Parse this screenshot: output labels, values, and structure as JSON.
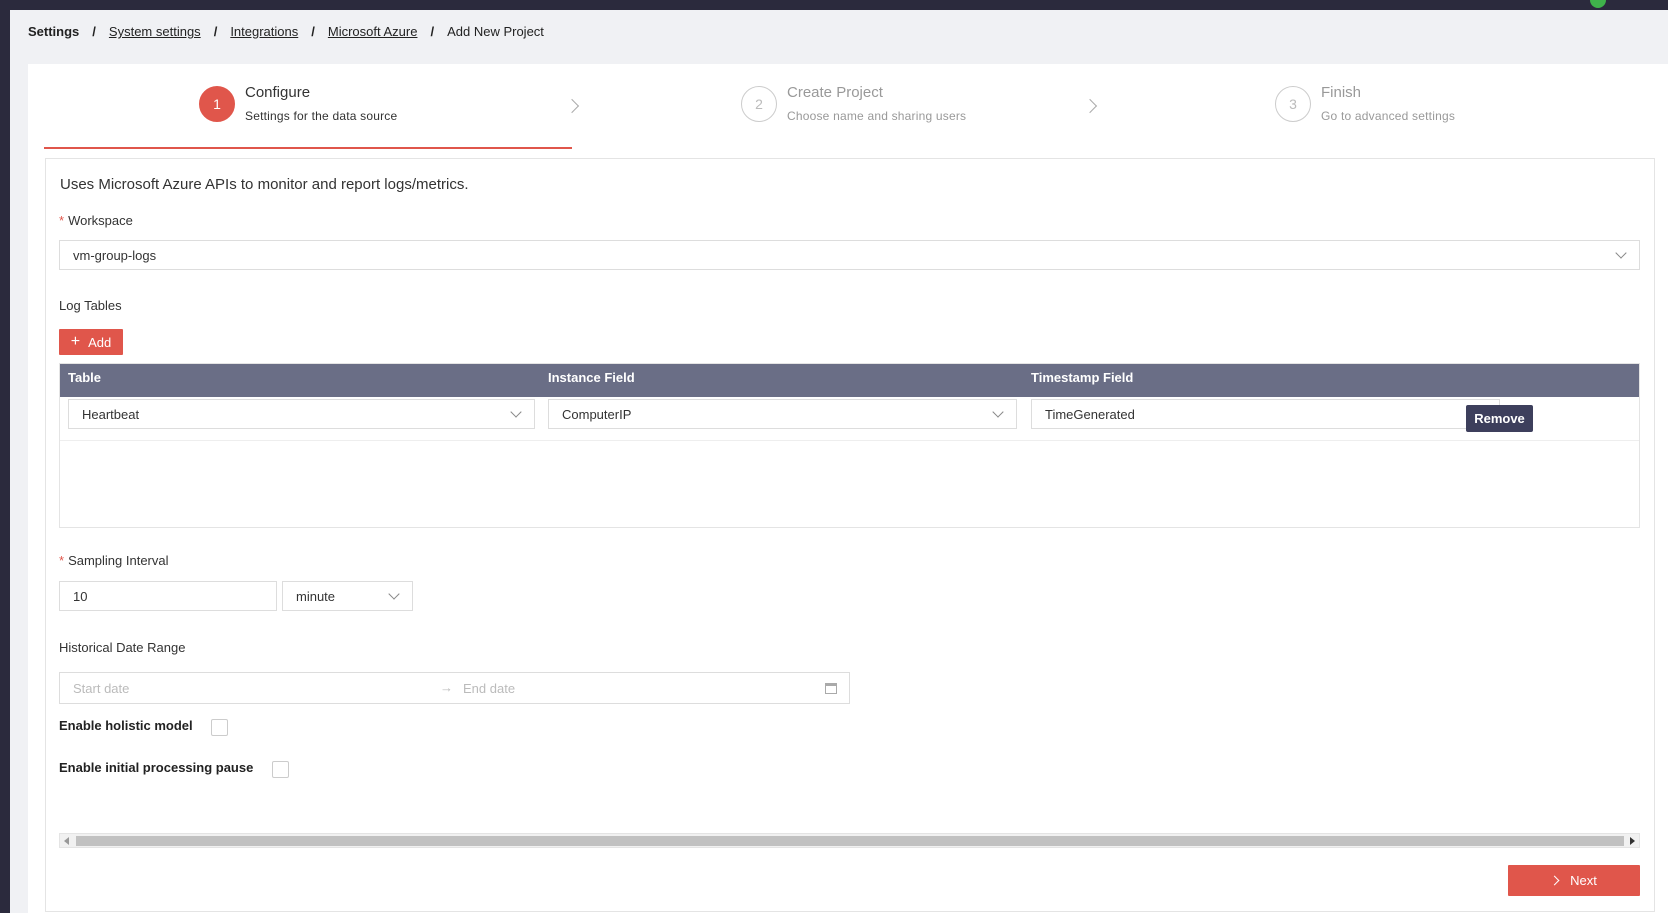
{
  "breadcrumb": {
    "root": "Settings",
    "items": [
      "System settings",
      "Integrations",
      "Microsoft Azure"
    ],
    "current": "Add New Project",
    "separator": "/"
  },
  "steps": [
    {
      "number": "1",
      "title": "Configure",
      "subtitle": "Settings for the data source",
      "active": true
    },
    {
      "number": "2",
      "title": "Create Project",
      "subtitle": "Choose name and sharing users",
      "active": false
    },
    {
      "number": "3",
      "title": "Finish",
      "subtitle": "Go to advanced settings",
      "active": false
    }
  ],
  "form": {
    "description": "Uses Microsoft Azure APIs to monitor and report logs/metrics.",
    "required_marker": "*",
    "workspace": {
      "label": "Workspace",
      "value": "vm-group-logs"
    },
    "log_tables": {
      "label": "Log Tables",
      "add_label": "Add",
      "columns": [
        "Table",
        "Instance Field",
        "Timestamp Field"
      ],
      "rows": [
        {
          "table": "Heartbeat",
          "instance_field": "ComputerIP",
          "timestamp_field": "TimeGenerated",
          "remove_label": "Remove"
        }
      ]
    },
    "sampling_interval": {
      "label": "Sampling Interval",
      "value": "10",
      "unit": "minute"
    },
    "historical_date_range": {
      "label": "Historical Date Range",
      "start_placeholder": "Start date",
      "end_placeholder": "End date",
      "arrow": "→"
    },
    "enable_holistic_model": {
      "label": "Enable holistic model",
      "checked": false
    },
    "enable_initial_processing_pause": {
      "label": "Enable initial processing pause",
      "checked": false
    }
  },
  "footer": {
    "next_label": "Next"
  },
  "colors": {
    "accent": "#e0564b",
    "table_header": "#6a6e86",
    "remove_button": "#3d3f5c",
    "topbar": "#2b2a3d"
  }
}
